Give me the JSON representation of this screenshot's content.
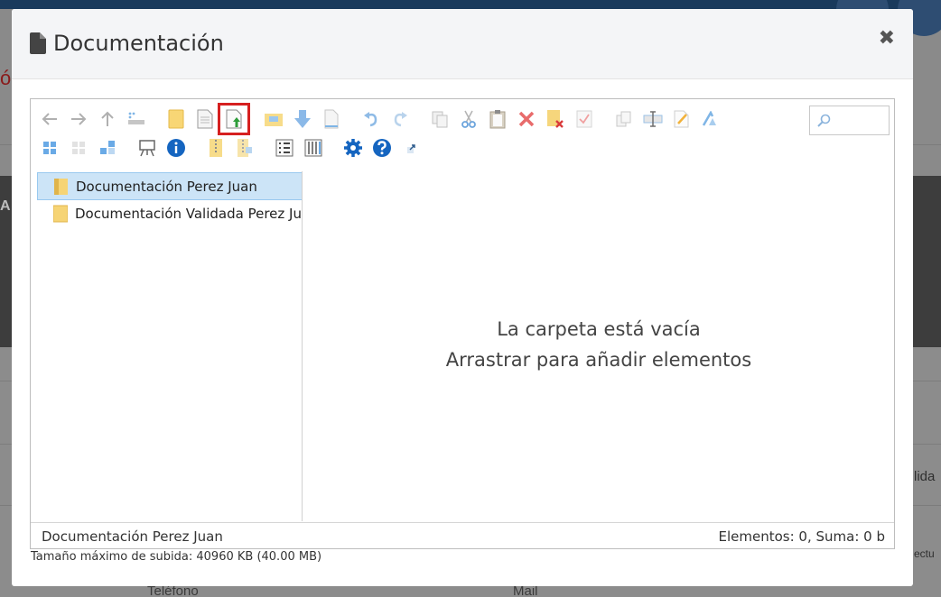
{
  "background": {
    "partial_right_text": "lida",
    "partial_right_text2": "ectu",
    "bottom_labels": [
      "Teléfono",
      "Mail"
    ],
    "partial_left_glyph": "ó",
    "partial_left_glyph2": "A"
  },
  "modal": {
    "title": "Documentación",
    "close_label": "✖"
  },
  "toolbar": {
    "row1": [
      "back-icon",
      "forward-icon",
      "up-icon",
      "reload-icon",
      "new-folder-icon",
      "new-file-icon",
      "upload-icon",
      "open-icon",
      "download-icon",
      "getfile-icon",
      "undo-icon",
      "redo-icon",
      "copy-icon",
      "cut-icon",
      "paste-icon",
      "delete-icon",
      "empty-folder-icon",
      "duplicate-icon",
      "rename-icon",
      "edit-icon",
      "resize-icon",
      "archive-icon"
    ],
    "row2": [
      "icons-view-icon",
      "grid-view-icon",
      "list-view-icon",
      "preview-icon",
      "info-icon",
      "extract-icon",
      "compress-icon",
      "columns-icon",
      "sort-icon",
      "settings-icon",
      "help-icon",
      "fullscreen-icon"
    ],
    "highlighted": "upload-icon"
  },
  "search": {
    "placeholder": ""
  },
  "tree": {
    "items": [
      {
        "label": "Documentación Perez Juan",
        "selected": true
      },
      {
        "label": "Documentación Validada Perez Juan",
        "selected": false
      }
    ]
  },
  "content": {
    "empty_line1": "La carpeta está vacía",
    "empty_line2": "Arrastrar para añadir elementos"
  },
  "status": {
    "path": "Documentación Perez Juan",
    "summary": "Elementos: 0, Suma: 0 b"
  },
  "upload_note": "Tamaño máximo de subida: 40960 KB (40.00 MB)",
  "colors": {
    "highlight_border": "#d62020",
    "selection_bg": "#cce4f7",
    "info_blue": "#1565c0"
  }
}
